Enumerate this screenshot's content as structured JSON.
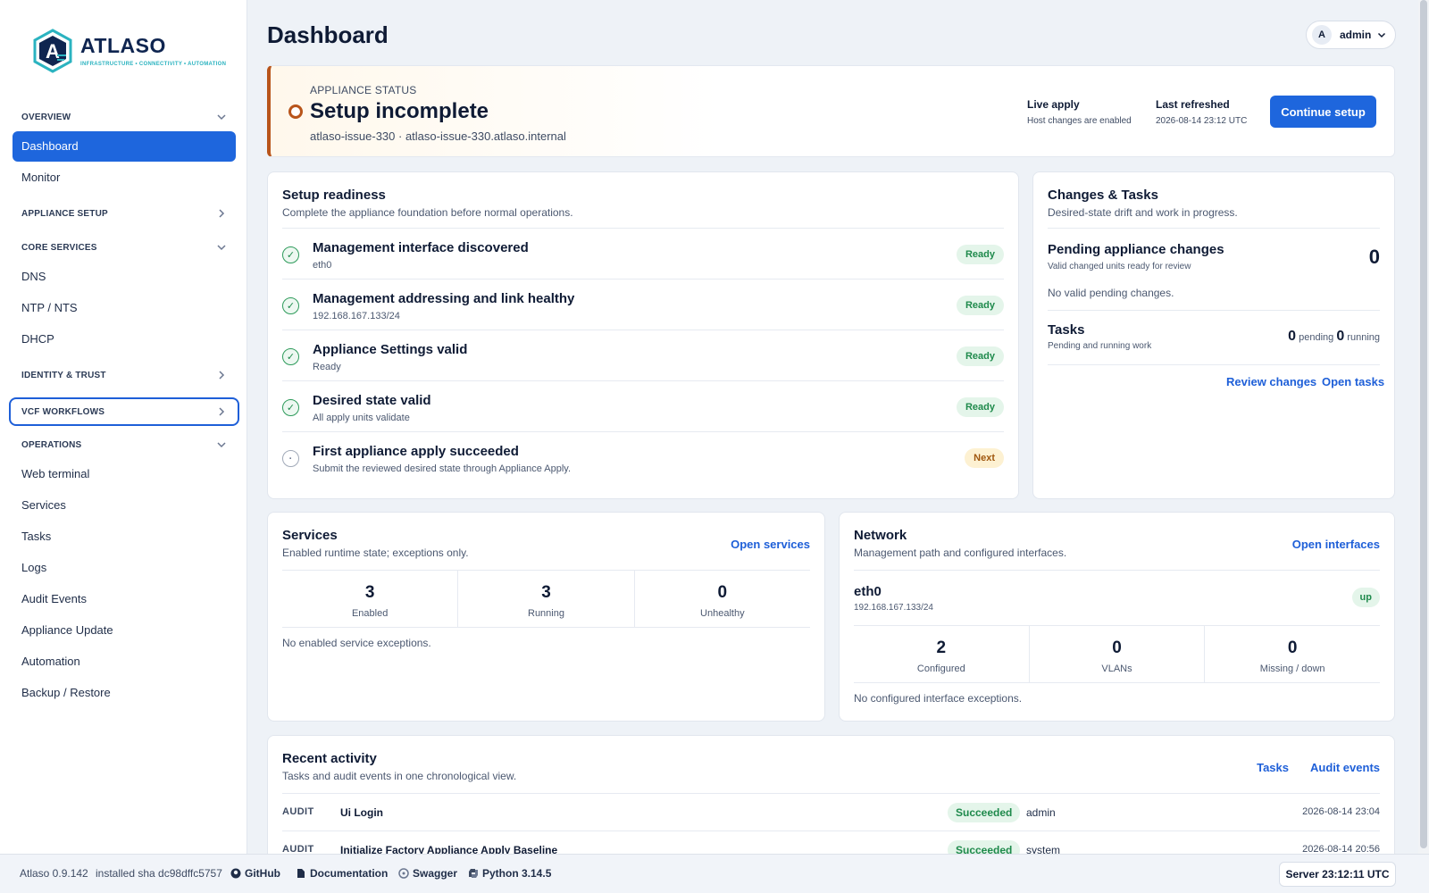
{
  "brand": {
    "name": "ATLASO",
    "tagline": "INFRASTRUCTURE • CONNECTIVITY • AUTOMATION",
    "accent": "#1e66dd"
  },
  "sidebar": {
    "sections": [
      {
        "label": "OVERVIEW",
        "expanded": true,
        "items": [
          "Dashboard",
          "Monitor"
        ]
      },
      {
        "label": "APPLIANCE SETUP",
        "expanded": false,
        "items": []
      },
      {
        "label": "CORE SERVICES",
        "expanded": true,
        "items": [
          "DNS",
          "NTP / NTS",
          "DHCP"
        ]
      },
      {
        "label": "IDENTITY & TRUST",
        "expanded": false,
        "items": []
      },
      {
        "label": "VCF WORKFLOWS",
        "expanded": false,
        "items": []
      },
      {
        "label": "OPERATIONS",
        "expanded": true,
        "items": [
          "Web terminal",
          "Services",
          "Tasks",
          "Logs",
          "Audit Events",
          "Appliance Update",
          "Automation",
          "Backup / Restore"
        ]
      }
    ],
    "active_item": "Dashboard"
  },
  "header": {
    "title": "Dashboard",
    "user_initial": "A",
    "user_name": "admin"
  },
  "status": {
    "kicker": "APPLIANCE STATUS",
    "title": "Setup incomplete",
    "subtitle": "atlaso-issue-330 · atlaso-issue-330.atlaso.internal",
    "live_apply_label": "Live apply",
    "live_apply_value": "Host changes are enabled",
    "last_refreshed_label": "Last refreshed",
    "last_refreshed_value": "2026-08-14 23:12 UTC",
    "button": "Continue setup"
  },
  "readiness": {
    "title": "Setup readiness",
    "subtitle": "Complete the appliance foundation before normal operations.",
    "rows": [
      {
        "title": "Management interface discovered",
        "sub": "eth0",
        "badge": "Ready",
        "done": true
      },
      {
        "title": "Management addressing and link healthy",
        "sub": "192.168.167.133/24",
        "badge": "Ready",
        "done": true
      },
      {
        "title": "Appliance Settings valid",
        "sub": "Ready",
        "badge": "Ready",
        "done": true
      },
      {
        "title": "Desired state valid",
        "sub": "All apply units validate",
        "badge": "Ready",
        "done": true
      },
      {
        "title": "First appliance apply succeeded",
        "sub": "Submit the reviewed desired state through Appliance Apply.",
        "badge": "Next",
        "done": false
      }
    ]
  },
  "changes": {
    "title": "Changes & Tasks",
    "subtitle": "Desired-state drift and work in progress.",
    "pending_title": "Pending appliance changes",
    "pending_sub": "Valid changed units ready for review",
    "pending_count": "0",
    "pending_note": "No valid pending changes.",
    "tasks_title": "Tasks",
    "tasks_sub": "Pending and running work",
    "tasks_pending": "0",
    "tasks_pending_label": "pending",
    "tasks_running": "0",
    "tasks_running_label": "running",
    "review_link": "Review changes",
    "tasks_link": "Open tasks"
  },
  "services": {
    "title": "Services",
    "subtitle": "Enabled runtime state; exceptions only.",
    "link": "Open services",
    "stats": [
      {
        "value": "3",
        "label": "Enabled"
      },
      {
        "value": "3",
        "label": "Running"
      },
      {
        "value": "0",
        "label": "Unhealthy"
      }
    ],
    "note": "No enabled service exceptions."
  },
  "network": {
    "title": "Network",
    "subtitle": "Management path and configured interfaces.",
    "link": "Open interfaces",
    "iface": "eth0",
    "iface_addr": "192.168.167.133/24",
    "iface_state": "up",
    "stats": [
      {
        "value": "2",
        "label": "Configured"
      },
      {
        "value": "0",
        "label": "VLANs"
      },
      {
        "value": "0",
        "label": "Missing / down"
      }
    ],
    "note": "No configured interface exceptions."
  },
  "activity": {
    "title": "Recent activity",
    "subtitle": "Tasks and audit events in one chronological view.",
    "link_tasks": "Tasks",
    "link_audit": "Audit events",
    "rows": [
      {
        "kind": "AUDIT",
        "title": "Ui Login",
        "status": "Succeeded",
        "actor": "admin",
        "time": "2026-08-14 23:04"
      },
      {
        "kind": "AUDIT",
        "title": "Initialize Factory Appliance Apply Baseline",
        "status": "Succeeded",
        "actor": "system",
        "time": "2026-08-14 20:56"
      }
    ]
  },
  "footer": {
    "version": "Atlaso 0.9.142",
    "sha": "installed sha dc98dffc5757",
    "github": "GitHub",
    "docs": "Documentation",
    "swagger": "Swagger",
    "python": "Python 3.14.5",
    "server_time": "Server 23:12:11 UTC"
  }
}
